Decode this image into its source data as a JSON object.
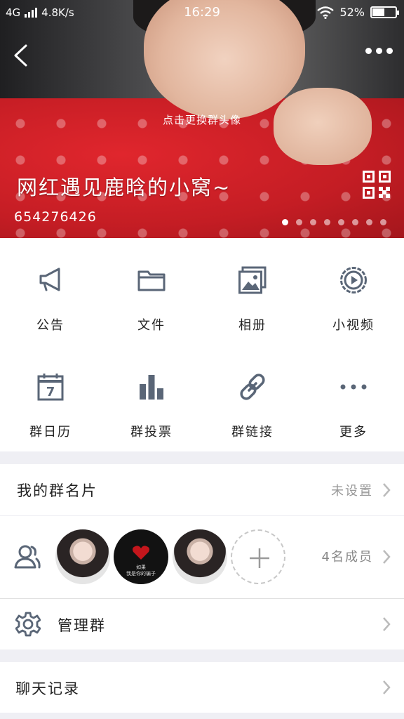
{
  "status_bar": {
    "network": "4G",
    "speed": "4.8K/s",
    "time": "16:29",
    "battery_text": "52%",
    "battery_level": 0.52
  },
  "header": {
    "avatar_hint": "点击更换群头像",
    "group_name": "网红遇见鹿晗的小窝~",
    "group_id": "654276426",
    "page_dots": 8,
    "active_dot": 0
  },
  "features": [
    {
      "label": "公告",
      "icon": "megaphone-icon"
    },
    {
      "label": "文件",
      "icon": "folder-icon"
    },
    {
      "label": "相册",
      "icon": "album-icon"
    },
    {
      "label": "小视频",
      "icon": "video-play-icon"
    },
    {
      "label": "群日历",
      "icon": "calendar-icon",
      "calendar_day": "7"
    },
    {
      "label": "群投票",
      "icon": "bar-chart-icon"
    },
    {
      "label": "群链接",
      "icon": "link-icon"
    },
    {
      "label": "更多",
      "icon": "more-dots-icon"
    }
  ],
  "group_card": {
    "label": "我的群名片",
    "value": "未设置"
  },
  "members": {
    "count_label": "4名成员",
    "avatar_note_top": "如果",
    "avatar_note_bottom": "我是你的骗子"
  },
  "manage": {
    "label": "管理群"
  },
  "history": {
    "label": "聊天记录"
  },
  "colors": {
    "icon_gray": "#5a6677",
    "text_dark": "#222222",
    "text_muted": "#999999",
    "background": "#efeff4"
  }
}
